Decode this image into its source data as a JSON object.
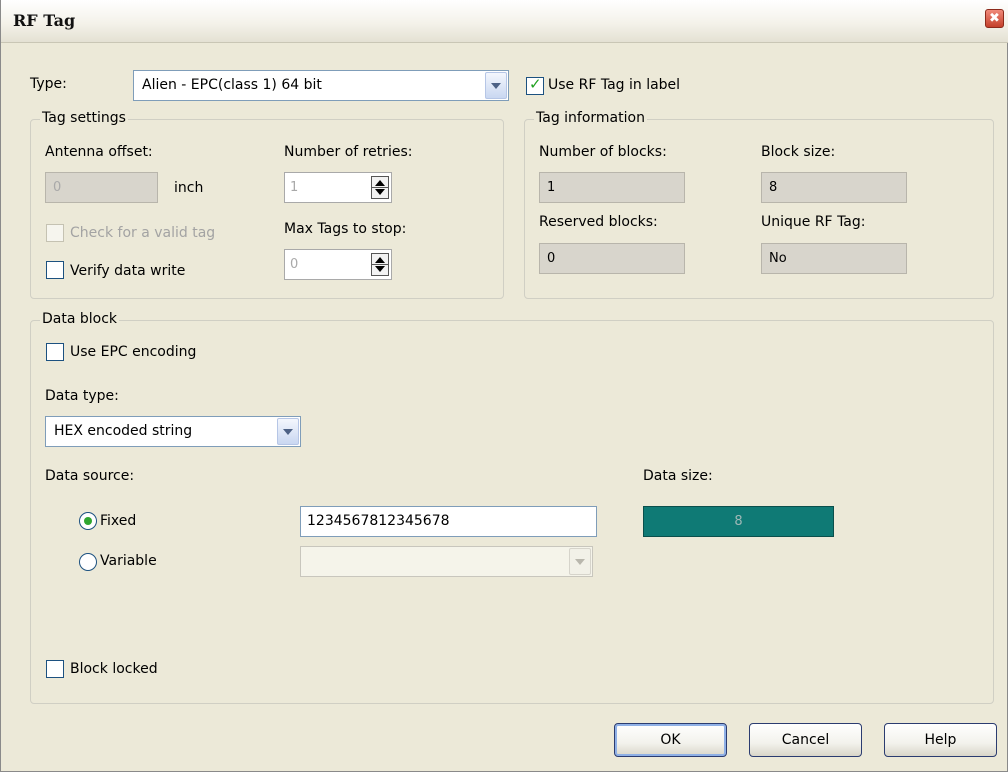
{
  "window": {
    "title": "RF Tag",
    "close_glyph": "✖"
  },
  "type": {
    "label": "Type:",
    "value": "Alien - EPC(class 1) 64 bit",
    "use_rf_tag_label": "Use RF Tag in label",
    "use_rf_tag_checked": true
  },
  "tag_settings": {
    "title": "Tag settings",
    "antenna_offset_label": "Antenna offset:",
    "antenna_offset_value": "0",
    "antenna_unit": "inch",
    "retries_label": "Number of retries:",
    "retries_value": "1",
    "check_valid_label": "Check for a valid tag",
    "max_tags_label": "Max Tags to stop:",
    "max_tags_value": "0",
    "verify_label": "Verify data write"
  },
  "tag_info": {
    "title": "Tag information",
    "blocks_label": "Number of blocks:",
    "blocks_value": "1",
    "block_size_label": "Block size:",
    "block_size_value": "8",
    "reserved_label": "Reserved blocks:",
    "reserved_value": "0",
    "unique_label": "Unique RF Tag:",
    "unique_value": "No"
  },
  "data_block": {
    "title": "Data block",
    "epc_label": "Use EPC encoding",
    "data_type_label": "Data type:",
    "data_type_value": "HEX encoded string",
    "source_label": "Data source:",
    "size_label": "Data size:",
    "fixed_label": "Fixed",
    "fixed_value": "1234567812345678",
    "variable_label": "Variable",
    "variable_value": "",
    "size_value": "8",
    "locked_label": "Block locked"
  },
  "buttons": {
    "ok": "OK",
    "cancel": "Cancel",
    "help": "Help"
  }
}
